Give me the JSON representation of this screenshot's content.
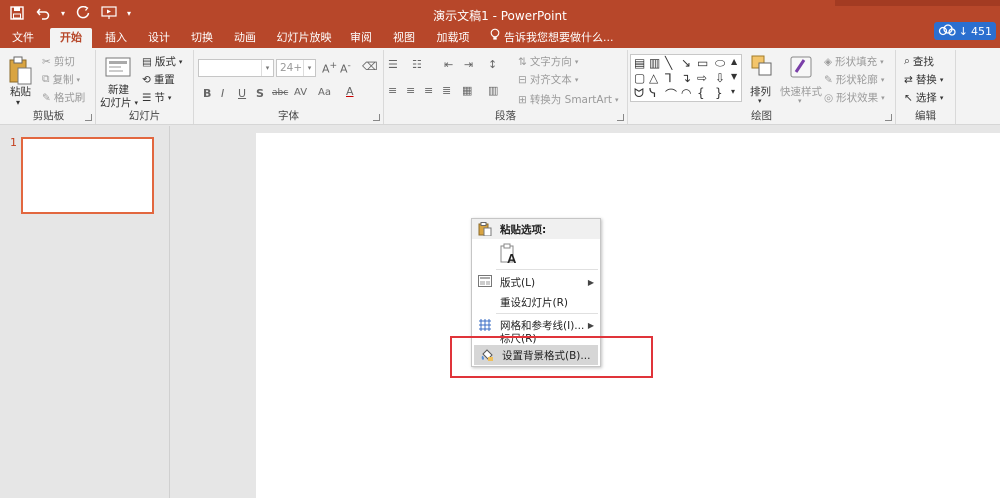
{
  "window": {
    "title": "演示文稿1 - PowerPoint"
  },
  "quick_access": {
    "items": [
      "save",
      "undo",
      "redo",
      "start-from-beginning",
      "customize"
    ]
  },
  "tabs": [
    {
      "label": "文件"
    },
    {
      "label": "开始"
    },
    {
      "label": "插入"
    },
    {
      "label": "设计"
    },
    {
      "label": "切换"
    },
    {
      "label": "动画"
    },
    {
      "label": "幻灯片放映"
    },
    {
      "label": "审阅"
    },
    {
      "label": "视图"
    },
    {
      "label": "加载项"
    }
  ],
  "tell_me": "告诉我您想要做什么...",
  "cloud_badge": "451",
  "ribbon": {
    "clipboard": {
      "label": "剪贴板",
      "paste": "粘贴",
      "cut": "剪切",
      "copy": "复制",
      "format_painter": "格式刷"
    },
    "slides": {
      "label": "幻灯片",
      "new_slide_line1": "新建",
      "new_slide_line2": "幻灯片",
      "layout": "版式",
      "reset": "重置",
      "section": "节"
    },
    "font": {
      "label": "字体",
      "size": "24+",
      "bold": "B",
      "italic": "I",
      "underline": "U",
      "shadow": "S",
      "strike": "abc",
      "spacing": "AV",
      "case": "Aa",
      "color": "A"
    },
    "paragraph": {
      "label": "段落",
      "text_direction": "文字方向",
      "align_text": "对齐文本",
      "smartart": "转换为 SmartArt"
    },
    "drawing": {
      "label": "绘图",
      "arrange": "排列",
      "quick_styles": "快速样式",
      "shape_fill": "形状填充",
      "shape_outline": "形状轮廓",
      "shape_effects": "形状效果"
    },
    "editing": {
      "label": "编辑",
      "find": "查找",
      "replace": "替换",
      "select": "选择"
    }
  },
  "slides_pane": {
    "slide_number": "1"
  },
  "context_menu": {
    "header": "粘贴选项:",
    "items": [
      {
        "label": "版式(L)",
        "has_submenu": true
      },
      {
        "label": "重设幻灯片(R)",
        "has_submenu": false
      },
      {
        "label": "网格和参考线(I)...",
        "has_submenu": true
      },
      {
        "label": "标尺(R)",
        "has_submenu": false
      },
      {
        "label": "设置背景格式(B)...",
        "has_submenu": false
      }
    ]
  },
  "colors": {
    "accent": "#b7472a",
    "thumb_border": "#e2673f",
    "highlight_box": "#e0343a"
  }
}
